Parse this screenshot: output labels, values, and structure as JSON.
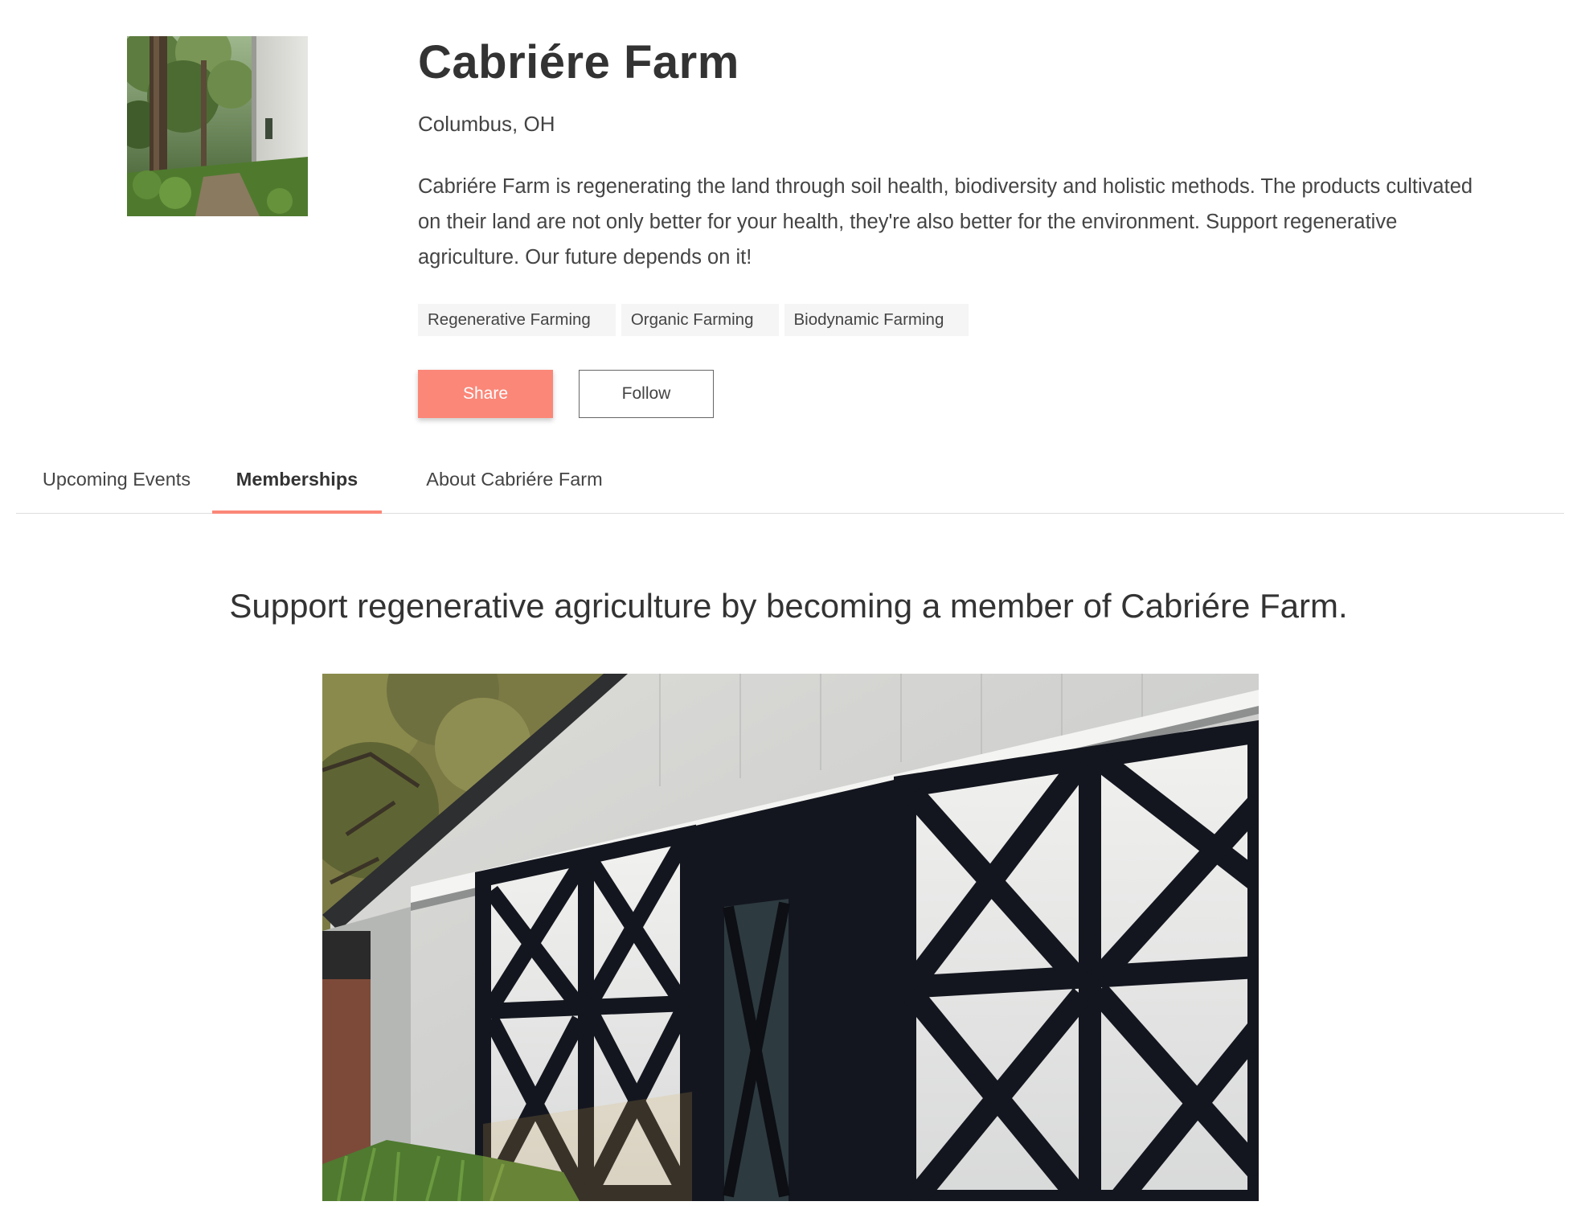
{
  "farm": {
    "name": "Cabriére Farm",
    "location": "Columbus, OH",
    "description": "Cabriére Farm is regenerating the land through soil health, biodiversity and holistic methods. The products cultivated on their land are not only better for your health, they're also better for the environment. Support regenerative agriculture. Our future depends on it!",
    "tags": [
      "Regenerative Farming",
      "Organic Farming",
      "Biodynamic Farming"
    ]
  },
  "actions": {
    "share_label": "Share",
    "follow_label": "Follow"
  },
  "tabs": [
    {
      "label": "Upcoming Events",
      "active": false
    },
    {
      "label": "Memberships",
      "active": true
    },
    {
      "label": "About Cabriére Farm",
      "active": false
    }
  ],
  "memberships": {
    "heading": "Support regenerative agriculture by becoming a member of Cabriére Farm."
  },
  "colors": {
    "accent": "#fb8778",
    "text": "#333333",
    "tag_bg": "#f5f5f5",
    "divider": "#dddddd"
  },
  "images": {
    "profile": "farm-path-photo",
    "banner": "barn-doors-photo"
  }
}
